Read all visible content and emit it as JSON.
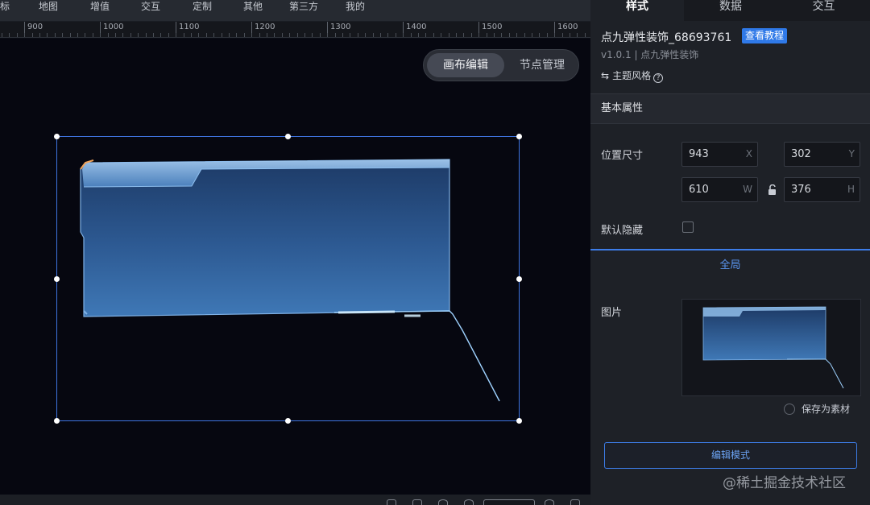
{
  "menu": {
    "items": [
      "标",
      "地图",
      "增值",
      "交互",
      "定制",
      "其他",
      "第三方",
      "我的"
    ]
  },
  "ruler": {
    "labels": [
      "900",
      "1000",
      "1100",
      "1200",
      "1300",
      "1400",
      "1500",
      "1600"
    ]
  },
  "canvas": {
    "mode_switch": {
      "active": "画布编辑",
      "other": "节点管理"
    }
  },
  "panel": {
    "tabs": [
      "样式",
      "数据",
      "交互"
    ],
    "active_tab": "样式",
    "component_title": "点九弹性装饰_68693761",
    "tutorial_button": "查看教程",
    "version": "v1.0.1 | 点九弹性装饰",
    "theme_label": "主题风格",
    "theme_icon": "swap-icon",
    "basic_props_title": "基本属性",
    "position_size_label": "位置尺寸",
    "fields": {
      "x": {
        "value": "943",
        "unit": "X"
      },
      "y": {
        "value": "302",
        "unit": "Y"
      },
      "w": {
        "value": "610",
        "unit": "W"
      },
      "h": {
        "value": "376",
        "unit": "H"
      }
    },
    "hidden_label": "默认隐藏",
    "hidden_checked": false,
    "global_tab": "全局",
    "image_label": "图片",
    "save_as_material": "保存为素材",
    "edit_mode_button": "编辑模式"
  },
  "watermark": "@稀土掘金技术社区",
  "colors": {
    "accent": "#3d7de8",
    "selection": "#3f74e0",
    "panel_bg": "#1e2127",
    "canvas_bg": "#060710"
  }
}
